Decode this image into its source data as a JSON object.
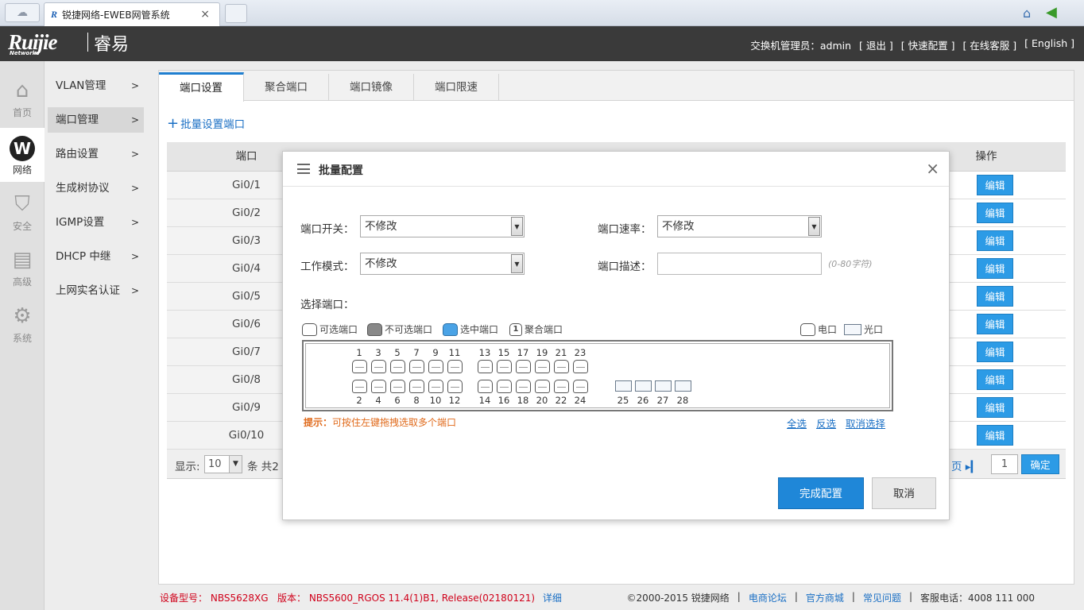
{
  "browser": {
    "tab_title": "锐捷网络-EWEB网管系统",
    "tab_logo": "R",
    "tab_close": "×"
  },
  "header": {
    "brand_logo": "Ruijie",
    "brand_sub": "Networks",
    "brand_name": "睿易",
    "admin_label": "交换机管理员：admin",
    "logout": "[ 退出 ]",
    "quick_config": "[ 快速配置 ]",
    "online_service": "[ 在线客服 ]",
    "english": "[ English ]"
  },
  "rail": {
    "items": [
      {
        "label": "首页",
        "icon": "home-icon"
      },
      {
        "label": "网络",
        "icon": "network-icon"
      },
      {
        "label": "安全",
        "icon": "shield-icon"
      },
      {
        "label": "高级",
        "icon": "briefcase-icon"
      },
      {
        "label": "系统",
        "icon": "gear-icon"
      }
    ],
    "active": "网络"
  },
  "submenu": {
    "items": [
      {
        "label": "VLAN管理"
      },
      {
        "label": "端口管理"
      },
      {
        "label": "路由设置"
      },
      {
        "label": "生成树协议"
      },
      {
        "label": "IGMP设置"
      },
      {
        "label": "DHCP 中继"
      },
      {
        "label": "上网实名认证"
      }
    ],
    "active": "端口管理",
    "chevron": ">"
  },
  "tabs": {
    "items": [
      {
        "label": "端口设置"
      },
      {
        "label": "聚合端口"
      },
      {
        "label": "端口镜像"
      },
      {
        "label": "端口限速"
      }
    ],
    "active": "端口设置"
  },
  "batch_link": "批量设置端口",
  "table": {
    "col_port": "端口",
    "col_op": "操作",
    "rows": [
      {
        "port": "Gi0/1"
      },
      {
        "port": "Gi0/2"
      },
      {
        "port": "Gi0/3"
      },
      {
        "port": "Gi0/4"
      },
      {
        "port": "Gi0/5"
      },
      {
        "port": "Gi0/6"
      },
      {
        "port": "Gi0/7"
      },
      {
        "port": "Gi0/8"
      },
      {
        "port": "Gi0/9"
      },
      {
        "port": "Gi0/10"
      }
    ],
    "edit_label": "编辑",
    "footer": {
      "show_label": "显示:",
      "page_size": "10",
      "count_label": "条 共2",
      "last_page": "页 ▸▎",
      "page_input": "1",
      "confirm": "确定"
    }
  },
  "modal": {
    "title": "批量配置",
    "close": "×",
    "port_switch_label": "端口开关：",
    "port_switch_value": "不修改",
    "port_speed_label": "端口速率：",
    "port_speed_value": "不修改",
    "work_mode_label": "工作模式：",
    "work_mode_value": "不修改",
    "port_desc_label": "端口描述：",
    "port_desc_value": "",
    "port_desc_hint": "(0-80字符)",
    "select_ports_label": "选择端口：",
    "legend": {
      "selectable": "可选端口",
      "unselectable": "不可选端口",
      "selected": "选中端口",
      "aggregate": "聚合端口",
      "aggregate_num": "1",
      "electric": "电口",
      "fiber": "光口"
    },
    "ports_top": [
      "1",
      "3",
      "5",
      "7",
      "9",
      "11",
      "13",
      "15",
      "17",
      "19",
      "21",
      "23"
    ],
    "ports_bottom": [
      "2",
      "4",
      "6",
      "8",
      "10",
      "12",
      "14",
      "16",
      "18",
      "20",
      "22",
      "24"
    ],
    "fiber_ports": [
      "25",
      "26",
      "27",
      "28"
    ],
    "hint_prefix": "提示：",
    "hint_text": "可按住左键拖拽选取多个端口",
    "select_all": "全选",
    "invert": "反选",
    "deselect": "取消选择",
    "finish": "完成配置",
    "cancel": "取消"
  },
  "footer": {
    "model_label": "设备型号：",
    "model_value": "NBS5628XG",
    "version_label": "版本：",
    "version_value": "NBS5600_RGOS 11.4(1)B1, Release(02180121)",
    "detail": "详细",
    "copyright": "©2000-2015 锐捷网络",
    "forum": "电商论坛",
    "mall": "官方商城",
    "faq": "常见问题",
    "hotline": "客服电话：4008 111 000",
    "sep": "|"
  }
}
